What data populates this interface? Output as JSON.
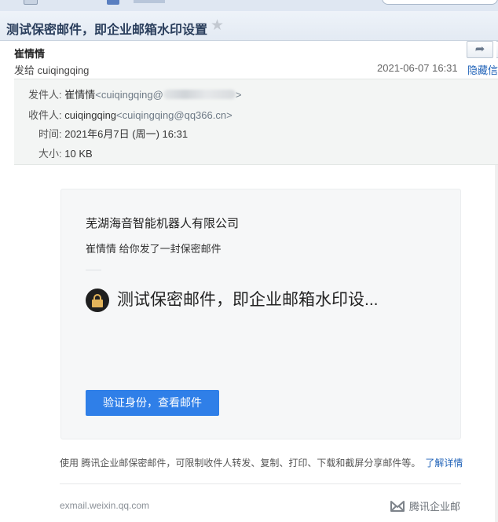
{
  "subject": "测试保密邮件，即企业邮箱水印设置",
  "header": {
    "sender_name": "崔情情",
    "to_prefix": "发给",
    "to_name": "cuiqingqing",
    "date": "2021-06-07 16:31",
    "hide_info_label": "隐藏信"
  },
  "details": {
    "from_label": "发件人:",
    "from_name": "崔情情",
    "from_email_start": "<cuiqingqing@",
    "from_email_end": ">",
    "to_label": "收件人:",
    "to_name": "cuiqingqing",
    "to_email": "<cuiqingqing@qq366.cn>",
    "time_label": "时间:",
    "time_value": "2021年6月7日 (周一) 16:31",
    "size_label": "大小:",
    "size_value": "10 KB"
  },
  "card": {
    "company": "芜湖海音智能机器人有限公司",
    "sentence": "崔情情 给你发了一封保密邮件",
    "secure_title": "测试保密邮件，即企业邮箱水印设...",
    "verify_button": "验证身份，查看邮件"
  },
  "footer": {
    "notice": "使用 腾讯企业邮保密邮件，可限制收件人转发、复制、打印、下载和截屏分享邮件等。",
    "learn_more": "了解详情",
    "domain": "exmail.weixin.qq.com",
    "brand": "腾讯企业邮"
  },
  "colors": {
    "accent_blue": "#2f7fe8",
    "link_blue": "#1f62b8",
    "lock_gold": "#e3b45b"
  }
}
